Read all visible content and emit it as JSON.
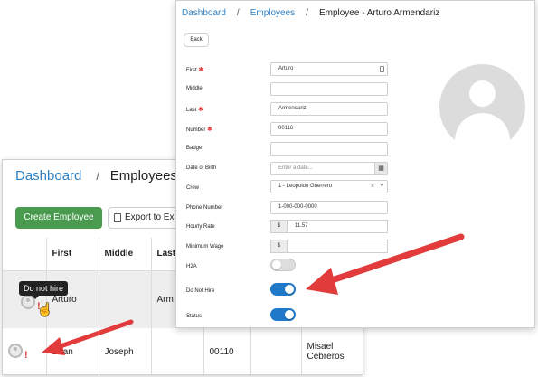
{
  "list_window": {
    "breadcrumb": {
      "dashboard": "Dashboard",
      "separator": "/",
      "employees": "Employees"
    },
    "create_button": "Create Employee",
    "export_button": "Export to Exc",
    "columns": [
      "",
      "First",
      "Middle",
      "Last",
      "",
      "",
      ""
    ],
    "rows": [
      {
        "first": "Arturo",
        "middle": "",
        "last": "Arm",
        "number": "",
        "c5": "",
        "crew": ""
      },
      {
        "first": "Brian",
        "middle": "Joseph",
        "last": "",
        "number": "00110",
        "c5": "",
        "crew": "Misael Cebreros"
      }
    ],
    "warning_mark": "!",
    "tooltip": "Do not hire",
    "hand_icon": "pointer-hand-icon"
  },
  "detail_window": {
    "breadcrumb": {
      "dashboard": "Dashboard",
      "separator": "/",
      "employees": "Employees",
      "separator2": "/",
      "current": "Employee - Arturo Armendariz"
    },
    "back_button": "Back",
    "required_mark": "✱",
    "fields": {
      "first": {
        "label": "First",
        "value": "Arturo"
      },
      "middle": {
        "label": "Middle",
        "value": ""
      },
      "last": {
        "label": "Last",
        "value": "Armendariz"
      },
      "number": {
        "label": "Number",
        "value": "00116"
      },
      "badge": {
        "label": "Badge",
        "value": ""
      },
      "dob": {
        "label": "Date of Birth",
        "placeholder": "Enter a date..."
      },
      "crew": {
        "label": "Crew",
        "value": "1 - Leopoldo Guerrero",
        "clear": "×",
        "caret": "▾"
      },
      "phone": {
        "label": "Phone Number",
        "value": "1-000-000-0000"
      },
      "hourly_rate": {
        "label": "Hourly Rate",
        "prefix": "$",
        "value": "11.57"
      },
      "minimum_wage": {
        "label": "Minimum Wage",
        "prefix": "$",
        "value": ""
      },
      "h2a": {
        "label": "H2A",
        "on": false
      },
      "do_not_hire": {
        "label": "Do Not Hire",
        "on": true
      },
      "status": {
        "label": "Status",
        "on": true
      }
    },
    "calendar_icon": "calendar-icon",
    "avatar_icon": "user-placeholder-icon"
  },
  "colors": {
    "link": "#2f7fc1",
    "primary_green": "#4a9b4f",
    "toggle_on": "#1f78c8",
    "arrow_red": "#e23b3b",
    "required_red": "#e23a3a"
  }
}
